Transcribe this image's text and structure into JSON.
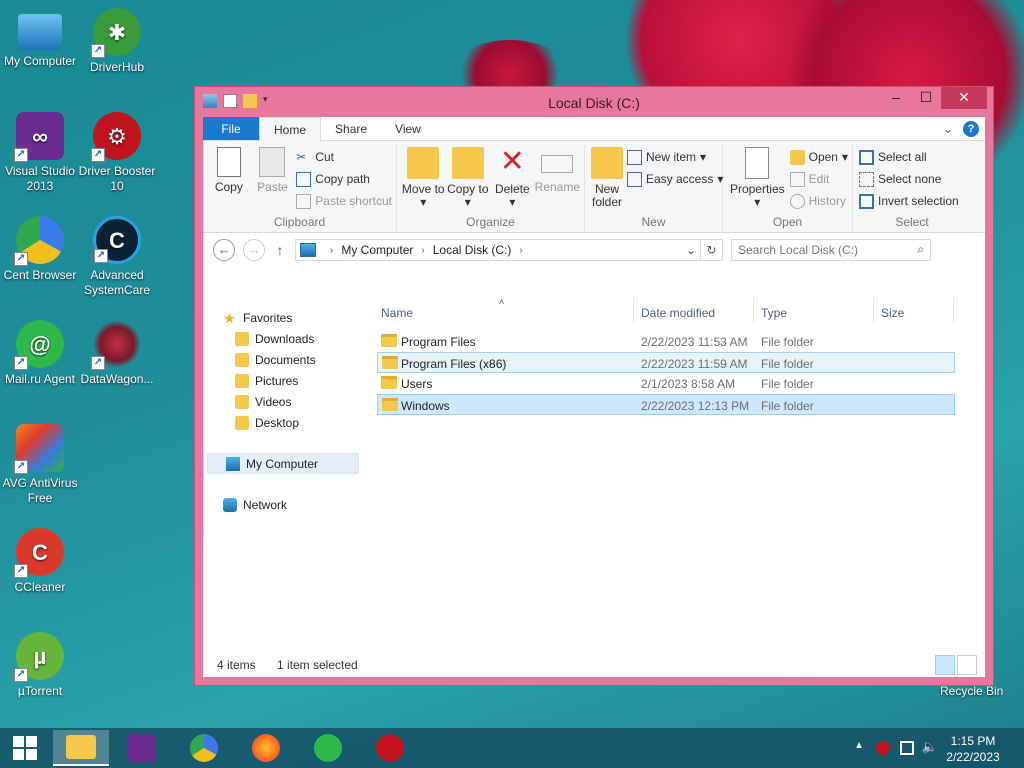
{
  "desktop": {
    "icons": [
      {
        "label": "My Computer"
      },
      {
        "label": "DriverHub"
      },
      {
        "label": "Visual Studio 2013"
      },
      {
        "label": "Driver Booster 10"
      },
      {
        "label": "Cent Browser"
      },
      {
        "label": "Advanced SystemCare"
      },
      {
        "label": "Mail.ru Agent"
      },
      {
        "label": "DataWagon..."
      },
      {
        "label": "AVG AntiVirus Free"
      },
      {
        "label": "CCleaner"
      },
      {
        "label": "µTorrent"
      }
    ],
    "recycle_bin": "Recycle Bin"
  },
  "window": {
    "title": "Local Disk (C:)",
    "tabs": [
      "File",
      "Home",
      "Share",
      "View"
    ],
    "ribbon": {
      "clipboard": {
        "label": "Clipboard",
        "copy": "Copy",
        "paste": "Paste",
        "cut": "Cut",
        "copy_path": "Copy path",
        "paste_shortcut": "Paste shortcut"
      },
      "organize": {
        "label": "Organize",
        "move_to": "Move to",
        "copy_to": "Copy to",
        "delete": "Delete",
        "rename": "Rename"
      },
      "new": {
        "label": "New",
        "new_folder": "New folder",
        "new_item": "New item",
        "easy_access": "Easy access"
      },
      "open": {
        "label": "Open",
        "properties": "Properties",
        "open": "Open",
        "edit": "Edit",
        "history": "History"
      },
      "select": {
        "label": "Select",
        "select_all": "Select all",
        "select_none": "Select none",
        "invert": "Invert selection"
      }
    },
    "address": {
      "crumbs": [
        "My Computer",
        "Local Disk (C:)"
      ],
      "search_placeholder": "Search Local Disk (C:)"
    },
    "nav": {
      "favorites": "Favorites",
      "fav_items": [
        "Downloads",
        "Documents",
        "Pictures",
        "Videos",
        "Desktop"
      ],
      "my_computer": "My Computer",
      "network": "Network"
    },
    "columns": {
      "name": "Name",
      "date": "Date modified",
      "type": "Type",
      "size": "Size"
    },
    "files": [
      {
        "name": "Program Files",
        "date": "2/22/2023 11:53 AM",
        "type": "File folder"
      },
      {
        "name": "Program Files (x86)",
        "date": "2/22/2023 11:59 AM",
        "type": "File folder"
      },
      {
        "name": "Users",
        "date": "2/1/2023 8:58 AM",
        "type": "File folder"
      },
      {
        "name": "Windows",
        "date": "2/22/2023 12:13 PM",
        "type": "File folder"
      }
    ],
    "status": {
      "count": "4 items",
      "selected": "1 item selected"
    }
  },
  "taskbar": {
    "time": "1:15 PM",
    "date": "2/22/2023"
  }
}
